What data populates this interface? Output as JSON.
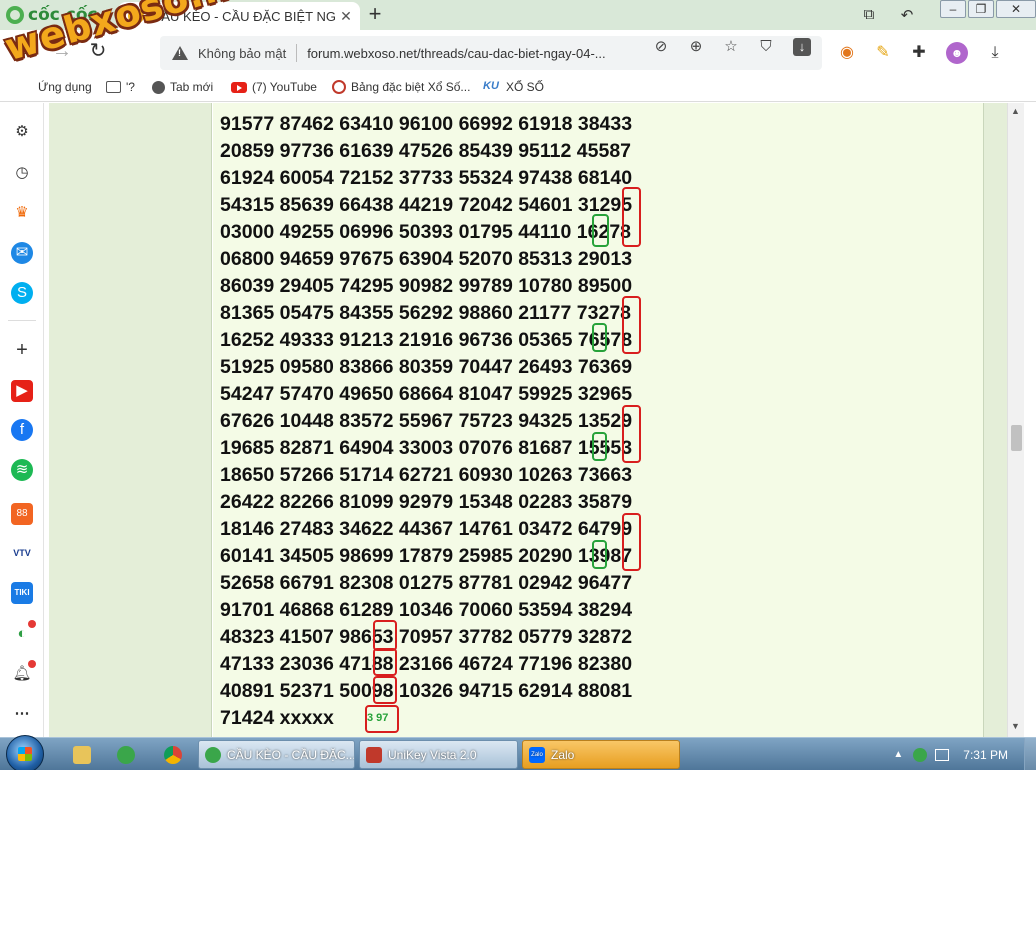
{
  "browser": {
    "brand": "cốc cốc",
    "tab": {
      "icon_text": "XS",
      "title": "CẦU KÈO - CẦU ĐẶC BIỆT NG"
    },
    "security_label": "Không bảo mật",
    "url": "forum.webxoso.net/threads/cau-dac-biet-ngay-04-...",
    "watermark": "webxoso.net"
  },
  "bookmarks": [
    "Ứng dụng",
    "'?",
    "Tab mới",
    "(7) YouTube",
    "Bảng đặc biệt Xổ Số...",
    "XỔ SỐ"
  ],
  "bookmark_ku_icon": "KU",
  "post": {
    "rows": [
      "91577 87462 63410 96100 66992 61918 38433",
      "20859 97736 61639 47526 85439 95112 45587",
      "61924 60054 72152 37733 55324 97438 68140",
      "54315 85639 66438 44219 72042 54601 31295",
      "03000 49255 06996 50393 01795 44110 16278",
      "06800 94659 97675 63904 52070 85313 29013",
      "86039 29405 74295 90982 99789 10780 89500",
      "81365 05475 84355 56292 98860 21177 73278",
      "16252 49333 91213 21916 96736 05365 76578",
      "51925 09580 83866 80359 70447 26493 76369",
      "54247 57470 49650 68664 81047 59925 32965",
      "67626 10448 83572 55967 75723 94325 13529",
      "19685 82871 64904 33003 07076 81687 15553",
      "18650 57266 51714 62721 60930 10263 73663",
      "26422 82266 81099 92979 15348 02283 35879",
      "18146 27483 34622 44367 14761 03472 64799",
      "60141 34505 98699 17879 25985 20290 13987",
      "52658 66791 82308 01275 87781 02942 96477",
      "91701 46868 61289 10346 70060 53594 38294",
      "48323 41507 98653 70957 37782 05779 32872",
      "47133 23036 47188 23166 46724 77196 82380",
      "40891 52371 50098 10326 94715 62914 88081",
      "71424 xxxxx"
    ],
    "prediction": "3 97"
  },
  "taskbar": {
    "tasks": [
      "CẦU KÈO - CẦU ĐẶC...",
      "UniKey Vista 2.0",
      "Zalo"
    ],
    "zalo_icon": "Zalo",
    "clock": "7:31 PM"
  }
}
